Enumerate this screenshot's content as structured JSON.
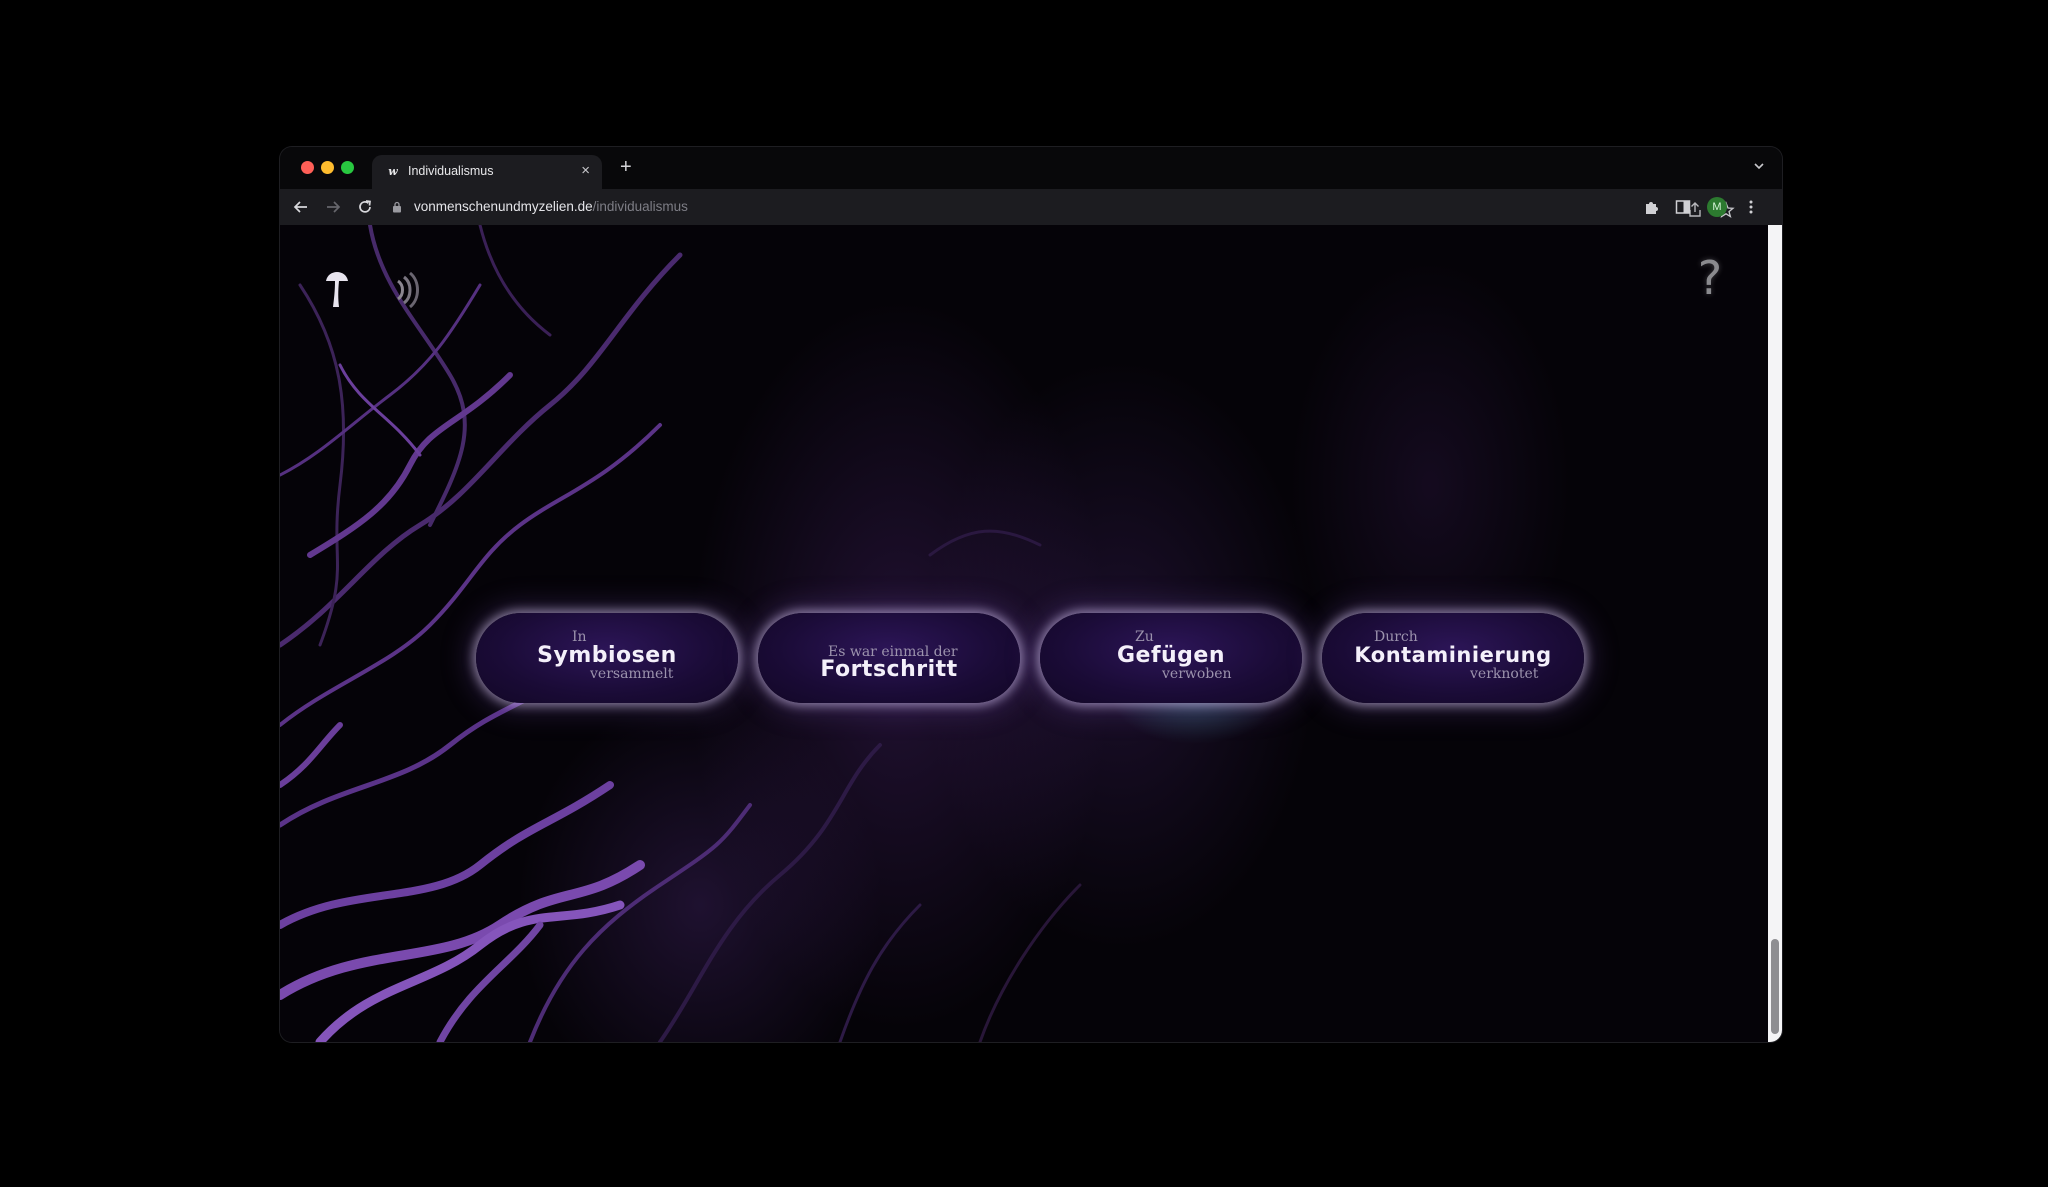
{
  "browser": {
    "tab_title": "Individualismus",
    "tab_favicon": "w",
    "url_host": "vonmenschenundmyzelien.de",
    "url_path": "/individualismus",
    "new_tab_label": "+",
    "close_label": "×",
    "avatar_initial": "M"
  },
  "page": {
    "help_label": "?",
    "choices": [
      {
        "pre": "In",
        "main": "Symbiosen",
        "post": "versammelt"
      },
      {
        "pre": "Es war einmal der",
        "main": "Fortschritt",
        "post": ""
      },
      {
        "pre": "Zu",
        "main": "Gefügen",
        "post": "verwoben"
      },
      {
        "pre": "Durch",
        "main": "Kontaminierung",
        "post": "verknotet"
      }
    ]
  },
  "icons": {
    "corner_left": [
      "mushroom-icon",
      "sound-icon"
    ],
    "corner_right": "help-icon"
  },
  "colors": {
    "background": "#000000",
    "accent_purple": "#2c1557",
    "pill_glow": "#d7c8f0",
    "mycelium": "#7a4aa8"
  }
}
